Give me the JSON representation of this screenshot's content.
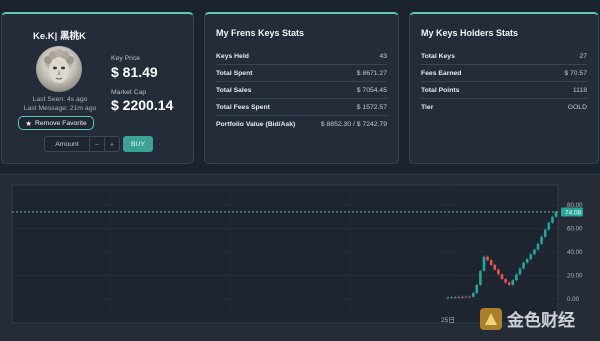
{
  "profile": {
    "username": "Ke.K| 黑桃K",
    "last_seen": "Last Seen: 4s ago",
    "last_message": "Last Message: 21m ago",
    "remove_favorite_label": "Remove Favorite",
    "key_price_label": "Key Price",
    "key_price_value": "$ 81.49",
    "market_cap_label": "Market Cap",
    "market_cap_value": "$ 2200.14",
    "amount_label": "Amount",
    "minus": "−",
    "plus": "+",
    "buy_label": "BUY",
    "avatar_icon": "statue-avatar"
  },
  "frens_stats": {
    "title": "My Frens Keys Stats",
    "rows": [
      {
        "key": "Keys Held",
        "value": "43"
      },
      {
        "key": "Total Spent",
        "value": "$ 8671.27"
      },
      {
        "key": "Total Sales",
        "value": "$ 7054.45"
      },
      {
        "key": "Total Fees Spent",
        "value": "$ 1572.57"
      },
      {
        "key": "Portfolio Value (Bid/Ask)",
        "value": "$ 8852.30 / $ 7242.79"
      }
    ]
  },
  "holders_stats": {
    "title": "My Keys Holders Stats",
    "rows": [
      {
        "key": "Total Keys",
        "value": "27"
      },
      {
        "key": "Fees Earned",
        "value": "$ 70.57"
      },
      {
        "key": "Total Points",
        "value": "1118"
      },
      {
        "key": "Tier",
        "value": "GOLD"
      }
    ]
  },
  "chart_data": {
    "type": "candlestick",
    "x_label_tick": "25日",
    "ylim": [
      0,
      80
    ],
    "y_ticks": [
      "80.00",
      "60.00",
      "40.00",
      "20.00",
      "0.00"
    ],
    "current_price": "74.08",
    "up_color": "#26a69a",
    "down_color": "#ef5350",
    "grid": true,
    "candles": [
      1.2,
      1.5,
      1.3,
      1.8,
      1.6,
      2.0,
      1.9,
      5,
      12,
      24,
      36,
      33,
      29,
      25,
      21,
      17,
      14,
      12,
      16,
      21,
      26,
      31,
      34,
      38,
      42,
      47,
      53,
      59,
      65,
      70,
      74.08
    ]
  },
  "watermark": {
    "text": "金色财经",
    "icon": "jinse-logo"
  }
}
